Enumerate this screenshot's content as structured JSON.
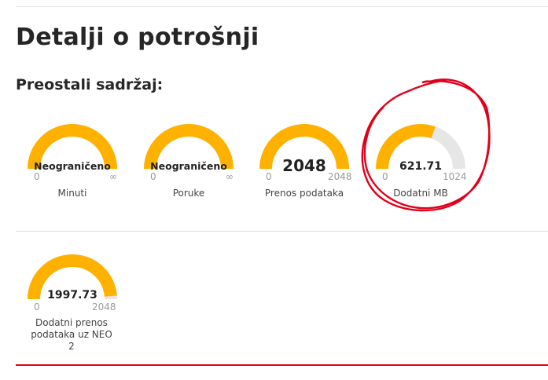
{
  "page": {
    "title": "Detalji o potrošnji",
    "subtitle": "Preostali sadržaj:"
  },
  "colors": {
    "fill": "#ffb100",
    "track": "#e6e6e6",
    "annotation": "#e1001a",
    "accent_line": "#e1001a"
  },
  "gauges": [
    {
      "value": "Neograničeno",
      "min": "0",
      "max": "∞",
      "label": "Minuti",
      "fraction": 1.0
    },
    {
      "value": "Neograničeno",
      "min": "0",
      "max": "∞",
      "label": "Poruke",
      "fraction": 1.0
    },
    {
      "value": "2048",
      "min": "0",
      "max": "2048",
      "label": "Prenos podataka",
      "fraction": 1.0
    },
    {
      "value": "621.71",
      "min": "0",
      "max": "1024",
      "label": "Dodatni MB",
      "fraction": 0.607
    },
    {
      "value": "1997.73",
      "min": "0",
      "max": "2048",
      "label": "Dodatni prenos podataka uz NEO 2",
      "fraction": 0.975
    }
  ]
}
